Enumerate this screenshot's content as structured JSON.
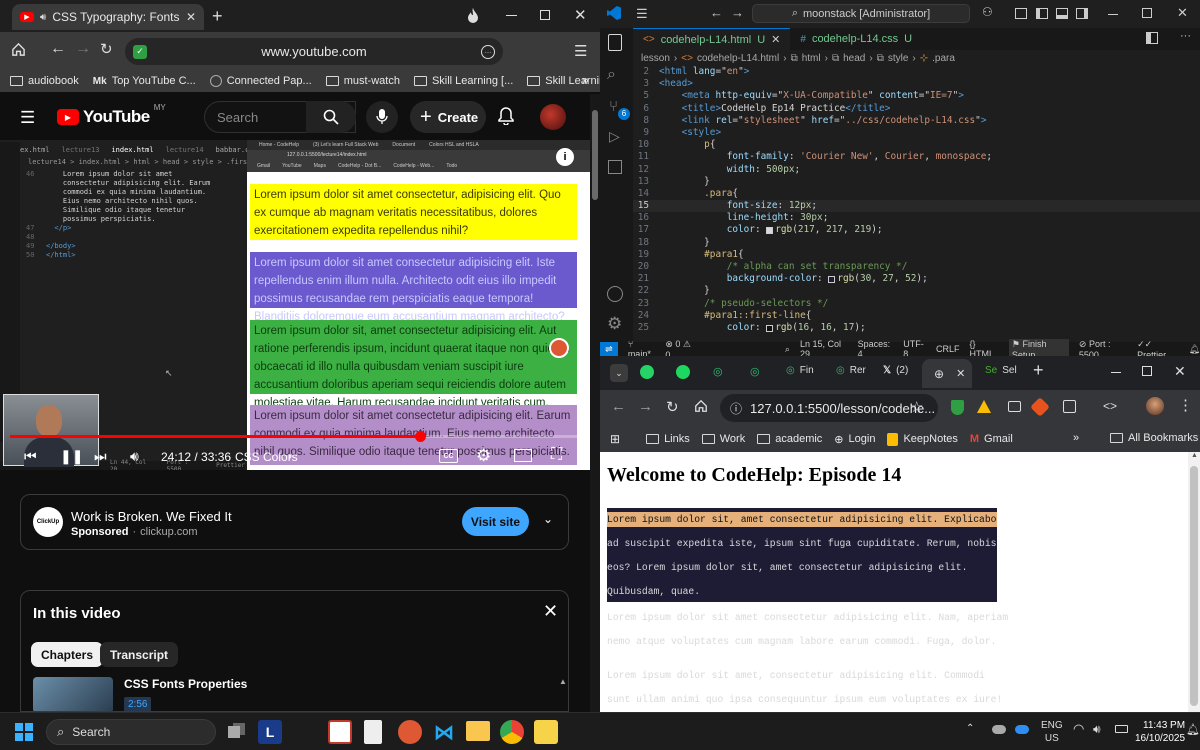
{
  "left_browser": {
    "tab_title": "CSS Typography: Fonts, Co",
    "url": "www.youtube.com",
    "bookmarks": [
      "audiobook",
      "Top YouTube C...",
      "Connected Pap...",
      "must-watch",
      "Skill Learning [...",
      "Skill Learning [..."
    ],
    "bookmark_badge": "Mk"
  },
  "youtube": {
    "logo_text": "YouTube",
    "region": "MY",
    "search_placeholder": "Search",
    "create_label": "Create",
    "video": {
      "time": "24:12 / 33:36",
      "chapter": "CSS Colors",
      "progress": 0.72,
      "code_tabs": [
        "ex.html",
        "index.html",
        "babbar.css"
      ],
      "code_tabs_sub": [
        "lecture13",
        "lecture14",
        ""
      ],
      "code_crumb": "lecture14 > index.html > html > head > style > .firstClass",
      "code_lines": [
        {
          "n": "46",
          "t": "    Lorem ipsum dolor sit amet"
        },
        {
          "n": "",
          "t": "    consectetur adipisicing elit. Earum"
        },
        {
          "n": "",
          "t": "    commodi ex quia minima laudantium."
        },
        {
          "n": "",
          "t": "    Eius nemo architecto nihil quos."
        },
        {
          "n": "",
          "t": "    Similique odio itaque tenetur"
        },
        {
          "n": "",
          "t": "    possimus perspiciatis."
        },
        {
          "n": "47",
          "t": "  </p>"
        },
        {
          "n": "48",
          "t": ""
        },
        {
          "n": "49",
          "t": "</body>"
        },
        {
          "n": "50",
          "t": "</html>"
        }
      ],
      "status_items": [
        "Ln 44, Col 20",
        "Port : 5500",
        "Prettier"
      ],
      "inner_url": "127.0.0.1:5500/lecture14/index.html",
      "inner_tabs": [
        "Home - CodeHelp",
        "(3) Let's learn Full Stack Web",
        "Document",
        "Colors HSL and HSLA"
      ],
      "inner_bookmarks": [
        "Gmail",
        "YouTube",
        "Maps",
        "CodeHelp - Dot B...",
        "CodeHelp - Web...",
        "Todo"
      ],
      "boxes": [
        {
          "text": "Lorem ipsum dolor sit amet consectetur, adipisicing elit. Quo ex cumque ab magnam veritatis necessitatibus, dolores exercitationem expedita repellendus nihil?",
          "bg": "#ffff00",
          "color": "#3b3b00"
        },
        {
          "text": "Lorem ipsum dolor sit amet consectetur adipisicing elit. Iste repellendus enim illum nulla. Architecto odit eius illo impedit possimus recusandae rem perspiciatis eaque tempora! Blanditiis doloremque eum accusantium magnam architecto?",
          "bg": "#6a5acd",
          "color": "#c8c8ff"
        },
        {
          "text": "Lorem ipsum dolor sit, amet consectetur adipisicing elit. Aut ratione perferendis ipsum, incidunt quaerat itaque non quidem obcaecati id illo nulla quibusdam veniam suscipit iure accusantium doloribus aperiam sequi reiciendis dolore autem molestiae vitae. Harum recusandae incidunt veritatis cum. Error!",
          "bg": "#3cb043",
          "color": "#0d3d10"
        },
        {
          "text": "Lorem ipsum dolor sit amet consectetur adipisicing elit. Earum commodi ex quia minima laudantium. Eius nemo architecto nihil quos. Similique odio itaque tenetur possimus perspiciatis.",
          "bg": "#b48ec8",
          "color": "#3a2a44"
        }
      ]
    },
    "ad": {
      "title": "Work is Broken. We Fixed It",
      "sponsored": "Sponsored",
      "domain": "clickup.com",
      "cta": "Visit site",
      "logo_label": "ClickUp"
    },
    "chapters": {
      "title": "In this video",
      "tab_chapters": "Chapters",
      "tab_transcript": "Transcript",
      "item_title": "CSS Fonts Properties",
      "item_time": "2:56"
    }
  },
  "vscode": {
    "search": "moonstack [Administrator]",
    "tabs": [
      {
        "label": "codehelp-L14.html",
        "flag": "U",
        "active": true
      },
      {
        "label": "codehelp-L14.css",
        "flag": "U",
        "active": false
      }
    ],
    "breadcrumb": [
      "lesson",
      "codehelp-L14.html",
      "html",
      "head",
      "style",
      ".para"
    ],
    "lines": [
      {
        "n": "2",
        "c": [
          [
            "tag",
            "<html"
          ],
          [
            "attr",
            " lang"
          ],
          [
            "p",
            "=\""
          ],
          [
            "str",
            "en"
          ],
          [
            "p",
            "\""
          ],
          [
            "tag",
            ">"
          ]
        ]
      },
      {
        "n": "3",
        "c": [
          [
            "tag",
            "<head>"
          ]
        ]
      },
      {
        "n": "5",
        "c": [
          [
            "p",
            "    "
          ],
          [
            "tag",
            "<meta"
          ],
          [
            "attr",
            " http-equiv"
          ],
          [
            "p",
            "=\""
          ],
          [
            "str",
            "X-UA-Compatible"
          ],
          [
            "p",
            "\""
          ],
          [
            "attr",
            " content"
          ],
          [
            "p",
            "=\""
          ],
          [
            "str",
            "IE=7"
          ],
          [
            "p",
            "\""
          ],
          [
            "tag",
            ">"
          ]
        ]
      },
      {
        "n": "6",
        "c": [
          [
            "p",
            "    "
          ],
          [
            "tag",
            "<title>"
          ],
          [
            "p",
            "CodeHelp Ep14 Practice"
          ],
          [
            "tag",
            "</title>"
          ]
        ]
      },
      {
        "n": "8",
        "c": [
          [
            "p",
            "    "
          ],
          [
            "tag",
            "<link"
          ],
          [
            "attr",
            " rel"
          ],
          [
            "p",
            "=\""
          ],
          [
            "str",
            "stylesheet"
          ],
          [
            "p",
            "\""
          ],
          [
            "attr",
            " href"
          ],
          [
            "p",
            "=\""
          ],
          [
            "str",
            "../css/codehelp-L14.css"
          ],
          [
            "p",
            "\""
          ],
          [
            "tag",
            ">"
          ]
        ]
      },
      {
        "n": "9",
        "c": [
          [
            "p",
            "    "
          ],
          [
            "tag",
            "<style>"
          ]
        ]
      },
      {
        "n": "10",
        "c": [
          [
            "p",
            "        "
          ],
          [
            "sel",
            "p"
          ],
          [
            "p",
            "{"
          ]
        ]
      },
      {
        "n": "11",
        "c": [
          [
            "p",
            "            "
          ],
          [
            "prop",
            "font-family"
          ],
          [
            "p",
            ": "
          ],
          [
            "str",
            "'Courier New'"
          ],
          [
            "p",
            ", "
          ],
          [
            "str",
            "Courier"
          ],
          [
            "p",
            ", "
          ],
          [
            "str",
            "monospace"
          ],
          [
            "p",
            ";"
          ]
        ]
      },
      {
        "n": "12",
        "c": [
          [
            "p",
            "            "
          ],
          [
            "prop",
            "width"
          ],
          [
            "p",
            ": "
          ],
          [
            "num",
            "500px"
          ],
          [
            "p",
            ";"
          ]
        ]
      },
      {
        "n": "13",
        "c": [
          [
            "p",
            "        }"
          ]
        ]
      },
      {
        "n": "14",
        "c": [
          [
            "p",
            "        "
          ],
          [
            "sel",
            ".para"
          ],
          [
            "p",
            "{"
          ]
        ]
      },
      {
        "n": "15",
        "c": [
          [
            "p",
            "            "
          ],
          [
            "prop",
            "font-size"
          ],
          [
            "p",
            ": "
          ],
          [
            "num",
            "12px"
          ],
          [
            "p",
            ";"
          ]
        ]
      },
      {
        "n": "16",
        "c": [
          [
            "p",
            "            "
          ],
          [
            "prop",
            "line-height"
          ],
          [
            "p",
            ": "
          ],
          [
            "num",
            "30px"
          ],
          [
            "p",
            ";"
          ]
        ]
      },
      {
        "n": "17",
        "c": [
          [
            "p",
            "            "
          ],
          [
            "prop",
            "color"
          ],
          [
            "p",
            ": "
          ],
          [
            "sw",
            "#d9d9db"
          ],
          [
            "fn",
            "rgb"
          ],
          [
            "p",
            "("
          ],
          [
            "num",
            "217"
          ],
          [
            "p",
            ", "
          ],
          [
            "num",
            "217"
          ],
          [
            "p",
            ", "
          ],
          [
            "num",
            "219"
          ],
          [
            "p",
            ");"
          ]
        ]
      },
      {
        "n": "18",
        "c": [
          [
            "p",
            "        }"
          ]
        ]
      },
      {
        "n": "19",
        "c": [
          [
            "p",
            "        "
          ],
          [
            "sel",
            "#para1"
          ],
          [
            "p",
            "{"
          ]
        ]
      },
      {
        "n": "20",
        "c": [
          [
            "p",
            "            "
          ],
          [
            "com",
            "/* alpha can set transparency */"
          ]
        ]
      },
      {
        "n": "21",
        "c": [
          [
            "p",
            "            "
          ],
          [
            "prop",
            "background-color"
          ],
          [
            "p",
            ": "
          ],
          [
            "sw",
            "#1e1b34"
          ],
          [
            "fn",
            "rgb"
          ],
          [
            "p",
            "("
          ],
          [
            "num",
            "30"
          ],
          [
            "p",
            ", "
          ],
          [
            "num",
            "27"
          ],
          [
            "p",
            ", "
          ],
          [
            "num",
            "52"
          ],
          [
            "p",
            ");"
          ]
        ]
      },
      {
        "n": "22",
        "c": [
          [
            "p",
            "        }"
          ]
        ]
      },
      {
        "n": "23",
        "c": [
          [
            "p",
            "        "
          ],
          [
            "com",
            "/* pseudo-selectors */"
          ]
        ]
      },
      {
        "n": "24",
        "c": [
          [
            "p",
            "        "
          ],
          [
            "sel",
            "#para1::first-line"
          ],
          [
            "p",
            "{"
          ]
        ]
      },
      {
        "n": "25",
        "c": [
          [
            "p",
            "            "
          ],
          [
            "prop",
            "color"
          ],
          [
            "p",
            ": "
          ],
          [
            "sw",
            "#101011"
          ],
          [
            "fn",
            "rgb"
          ],
          [
            "p",
            "("
          ],
          [
            "num",
            "16"
          ],
          [
            "p",
            ", "
          ],
          [
            "num",
            "16"
          ],
          [
            "p",
            ", "
          ],
          [
            "num",
            "17"
          ],
          [
            "p",
            ");"
          ]
        ]
      }
    ],
    "status": {
      "branch": "main*",
      "errors": "0",
      "warnings": "0",
      "position": "Ln 15, Col 29",
      "spaces": "Spaces: 4",
      "encoding": "UTF-8",
      "eol": "CRLF",
      "lang": "HTML",
      "setup": "Finish Setup",
      "port": "Port : 5500",
      "prettier": "Prettier"
    }
  },
  "right_chrome": {
    "tabs": [
      "",
      "Fin",
      "Rer",
      "(2)",
      "Sel"
    ],
    "url": "127.0.0.1:5500/lesson/codehe...",
    "bookmarks": [
      "Links",
      "Work",
      "academic",
      "Login",
      "KeepNotes",
      "Gmail"
    ],
    "all_bookmarks": "All Bookmarks",
    "page": {
      "heading": "Welcome to CodeHelp: Episode 14",
      "para1": {
        "first_line": "Lorem ipsum dolor sit, amet consectetur adipisicing elit. Explicabo",
        "rest": [
          "ad suscipit expedita iste, ipsum sint fuga cupiditate. Rerum, nobis",
          "eos? Lorem ipsum dolor sit, amet consectetur adipisicing elit.",
          "Quibusdam, quae."
        ]
      },
      "para2": [
        "Lorem ipsum dolor sit amet consectetur adipisicing elit. Nam, aperiam",
        "nemo atque voluptates cum magnam labore earum commodi. Fuga, dolor."
      ],
      "para3": [
        "Lorem ipsum dolor sit amet, consectetur adipisicing elit. Commodi",
        "sunt ullam animi quo ipsa consequuntur ipsum eum voluptates ex iure!"
      ]
    }
  },
  "taskbar": {
    "search": "Search",
    "lang": "ENG",
    "region": "US",
    "time": "11:43 PM",
    "date": "16/10/2025"
  }
}
